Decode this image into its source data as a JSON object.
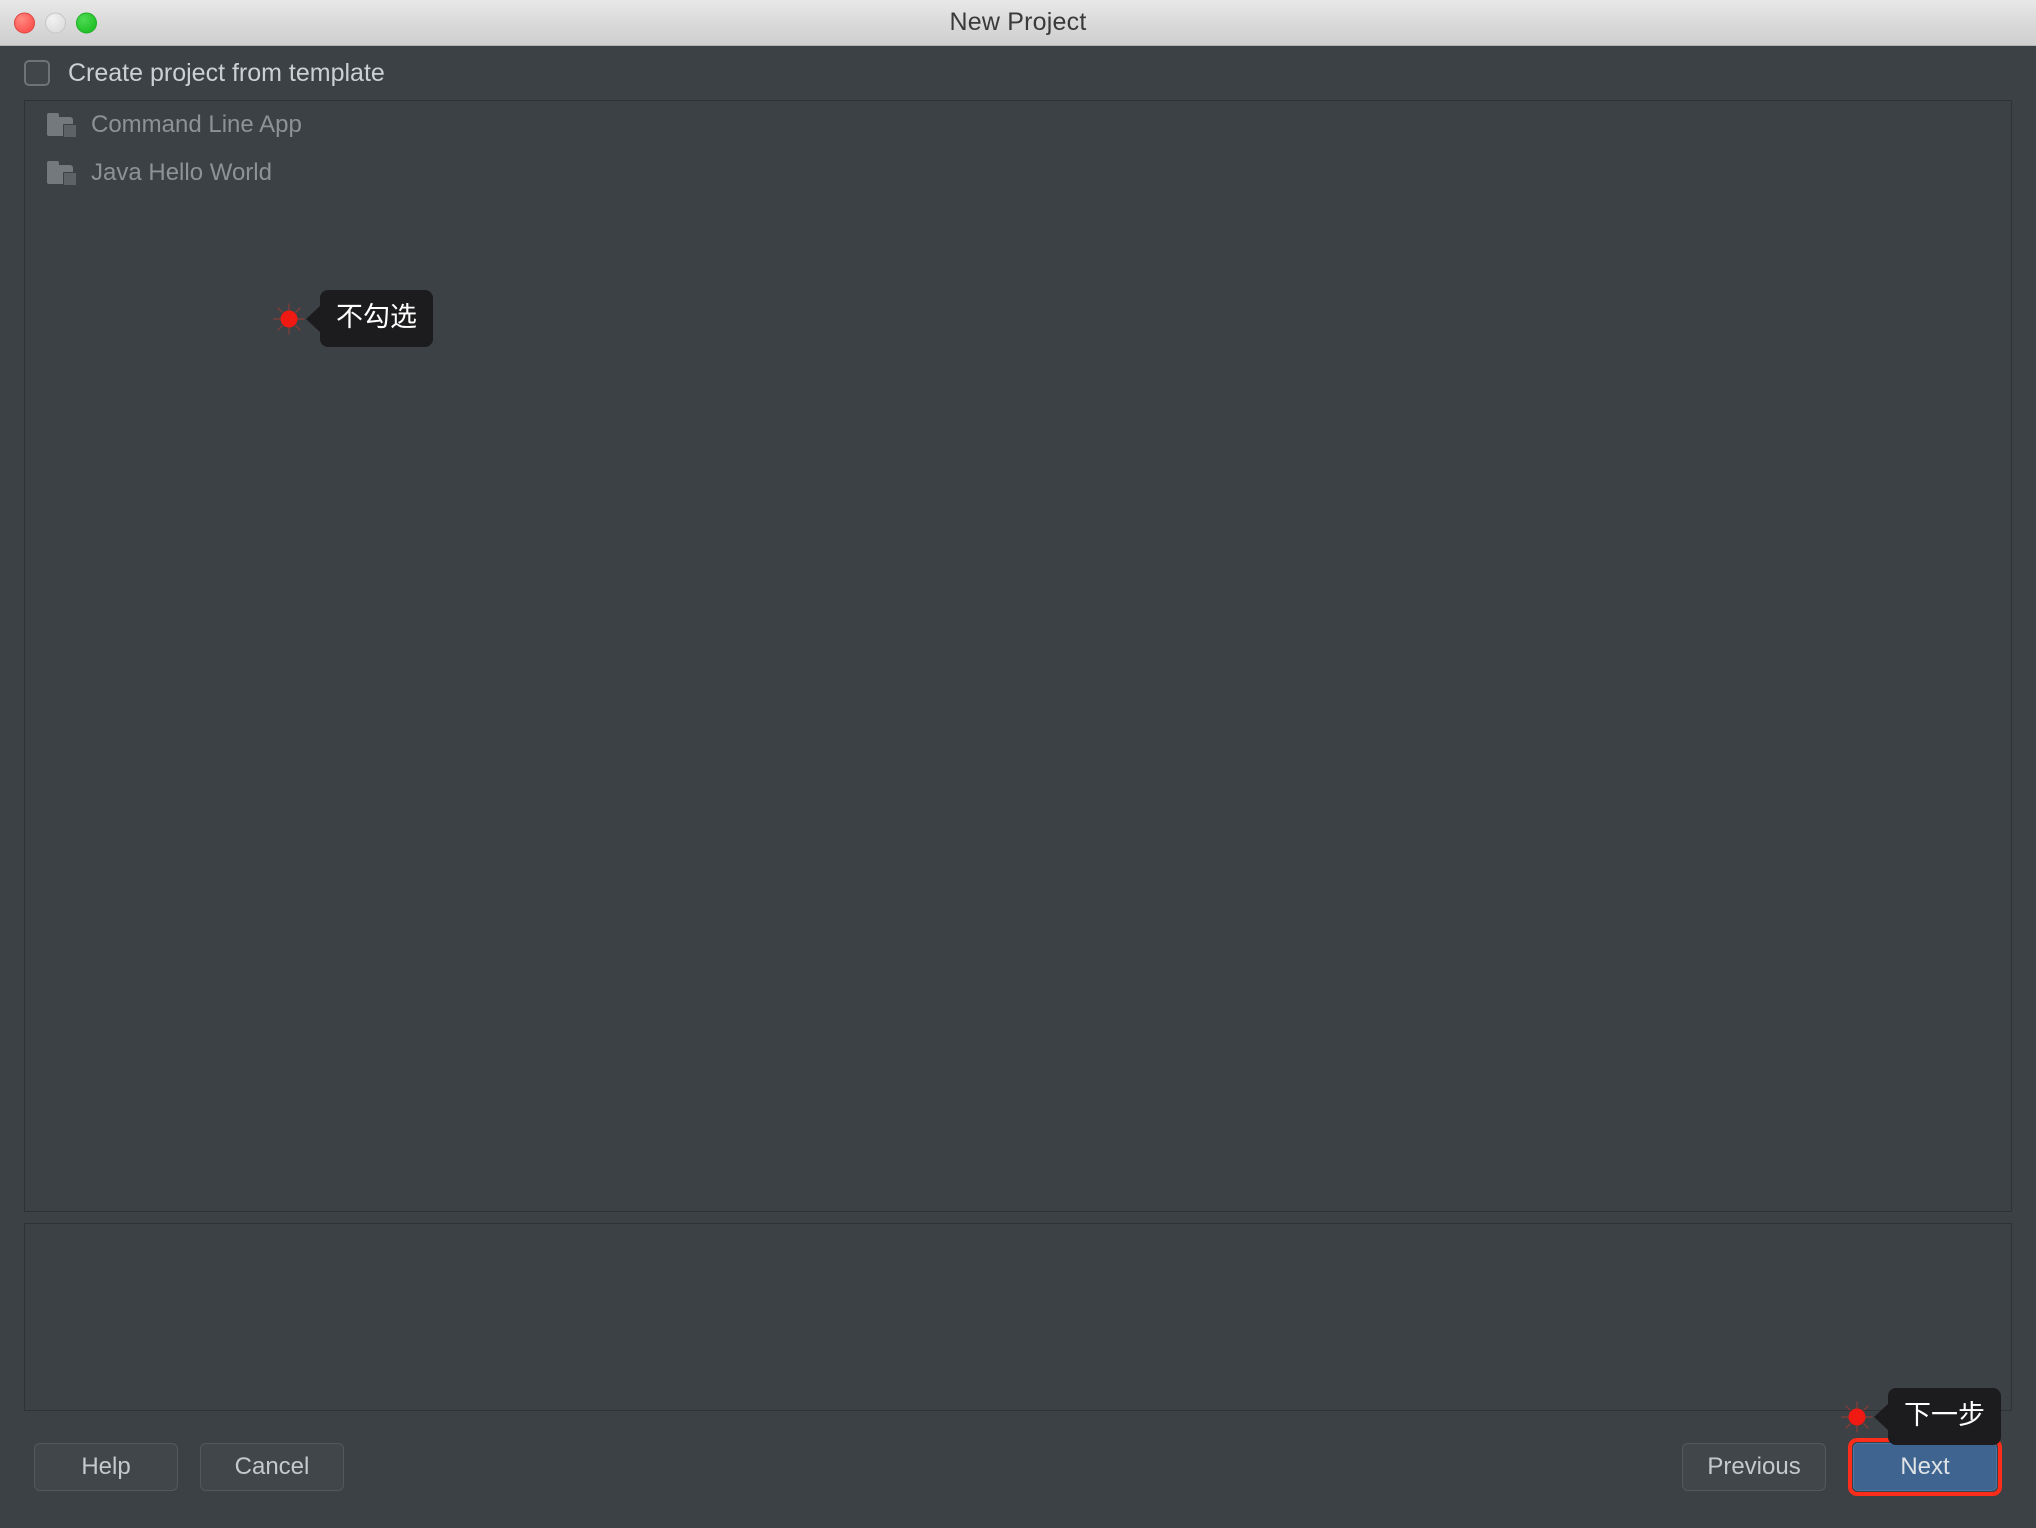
{
  "window": {
    "title": "New Project",
    "controls": [
      {
        "name": "close",
        "icon": "close-traffic-light"
      },
      {
        "name": "minimize",
        "icon": "minimize-traffic-light"
      },
      {
        "name": "maximize",
        "icon": "maximize-traffic-light"
      }
    ]
  },
  "template_checkbox": {
    "label": "Create project from template",
    "checked": false
  },
  "template_list": {
    "items": [
      {
        "label": "Command Line App",
        "icon": "folder-icon"
      },
      {
        "label": "Java Hello World",
        "icon": "folder-icon"
      }
    ]
  },
  "info_panel": {
    "text": ""
  },
  "footer": {
    "help_label": "Help",
    "cancel_label": "Cancel",
    "previous_label": "Previous",
    "next_label": "Next"
  },
  "annotations": [
    {
      "text": "不勾选",
      "target": "template-checkbox",
      "marker": "red-dot-marker"
    },
    {
      "text": "下一步",
      "target": "next-button",
      "marker": "red-dot-marker"
    }
  ],
  "colors": {
    "window_bg": "#3c4145",
    "titlebar_bg": "#d9d9d9",
    "panel_border": "#2f3336",
    "text_primary": "#cdd0d3",
    "text_muted": "#8d9296",
    "primary_button": "#3e648f",
    "highlight_outline": "#fd2d1b",
    "annotation_bg": "#1c1c1e",
    "marker_red": "#f11a12"
  }
}
